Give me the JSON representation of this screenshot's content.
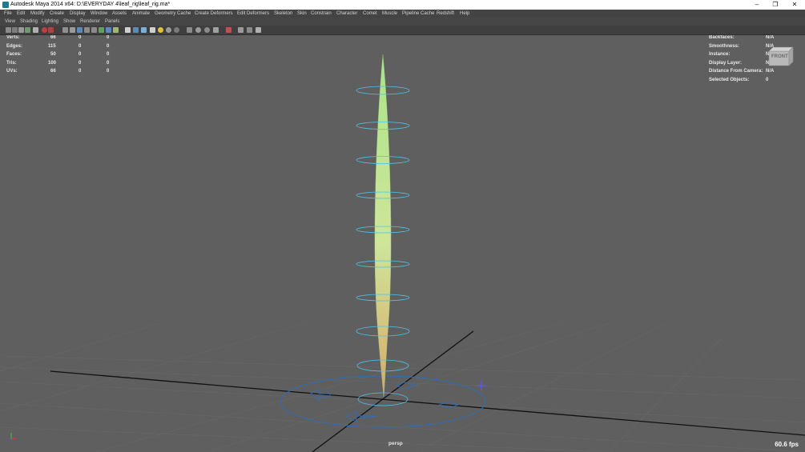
{
  "window": {
    "title": "Autodesk Maya 2014 x64: D:\\EVERYDAY 4\\leaf_rig\\leaf_rig.ma*",
    "controls": [
      "–",
      "❐",
      "✕"
    ]
  },
  "menubar": [
    "File",
    "Edit",
    "Modify",
    "Create",
    "Display",
    "Window",
    "Assets",
    "Animate",
    "Geometry Cache",
    "Create Deformers",
    "Edit Deformers",
    "Skeleton",
    "Skin",
    "Constrain",
    "Character",
    "Comet",
    "Muscle",
    "Pipeline Cache",
    "Redshift",
    "Help"
  ],
  "panel_menu": [
    "View",
    "Shading",
    "Lighting",
    "Show",
    "Renderer",
    "Panels"
  ],
  "hud_left": {
    "rows": [
      {
        "label": "Verts:",
        "a": "66",
        "b": "0",
        "c": "0"
      },
      {
        "label": "Edges:",
        "a": "115",
        "b": "0",
        "c": "0"
      },
      {
        "label": "Faces:",
        "a": "50",
        "b": "0",
        "c": "0"
      },
      {
        "label": "Tris:",
        "a": "100",
        "b": "0",
        "c": "0"
      },
      {
        "label": "UVs:",
        "a": "66",
        "b": "0",
        "c": "0"
      }
    ]
  },
  "hud_right": {
    "rows": [
      {
        "label": "Backfaces:",
        "value": "N/A"
      },
      {
        "label": "Smoothness:",
        "value": "N/A"
      },
      {
        "label": "Instance:",
        "value": "N/A"
      },
      {
        "label": "Display Layer:",
        "value": "N/A"
      },
      {
        "label": "Distance From Camera:",
        "value": "N/A"
      },
      {
        "label": "Selected Objects:",
        "value": "0"
      }
    ]
  },
  "viewcube_label": "FRONT",
  "camera_label": "persp",
  "fps": "60.6 fps",
  "colors": {
    "curve": "#4fc3e8",
    "ground_circle": "#2f6fb5",
    "leaf_top": "#a9e58a",
    "leaf_bottom": "#d9b47a",
    "grid": "#6a6a6a",
    "axis": "#111111"
  }
}
